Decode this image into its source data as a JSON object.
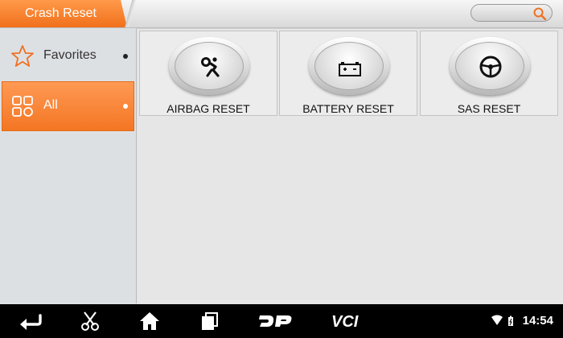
{
  "header": {
    "title": "Crash Reset",
    "search_placeholder": ""
  },
  "sidebar": {
    "items": [
      {
        "label": "Favorites",
        "icon": "star-icon",
        "selected": false
      },
      {
        "label": "All",
        "icon": "grid-icon",
        "selected": true
      }
    ]
  },
  "main": {
    "tiles": [
      {
        "label": "AIRBAG RESET",
        "icon": "airbag-icon"
      },
      {
        "label": "BATTERY RESET",
        "icon": "battery-icon"
      },
      {
        "label": "SAS RESET",
        "icon": "steering-wheel-icon"
      }
    ]
  },
  "navbar": {
    "buttons": [
      {
        "name": "back",
        "icon": "back-arrow-icon"
      },
      {
        "name": "screenshot",
        "icon": "scissors-icon"
      },
      {
        "name": "home",
        "icon": "home-icon"
      },
      {
        "name": "recent-apps",
        "icon": "recent-apps-icon"
      },
      {
        "name": "dp",
        "icon": "dp-icon",
        "text": "DP"
      },
      {
        "name": "vci",
        "icon": "vci-icon",
        "text": "VCI"
      }
    ],
    "time": "14:54"
  },
  "colors": {
    "accent": "#f37522",
    "navbar": "#000000"
  }
}
